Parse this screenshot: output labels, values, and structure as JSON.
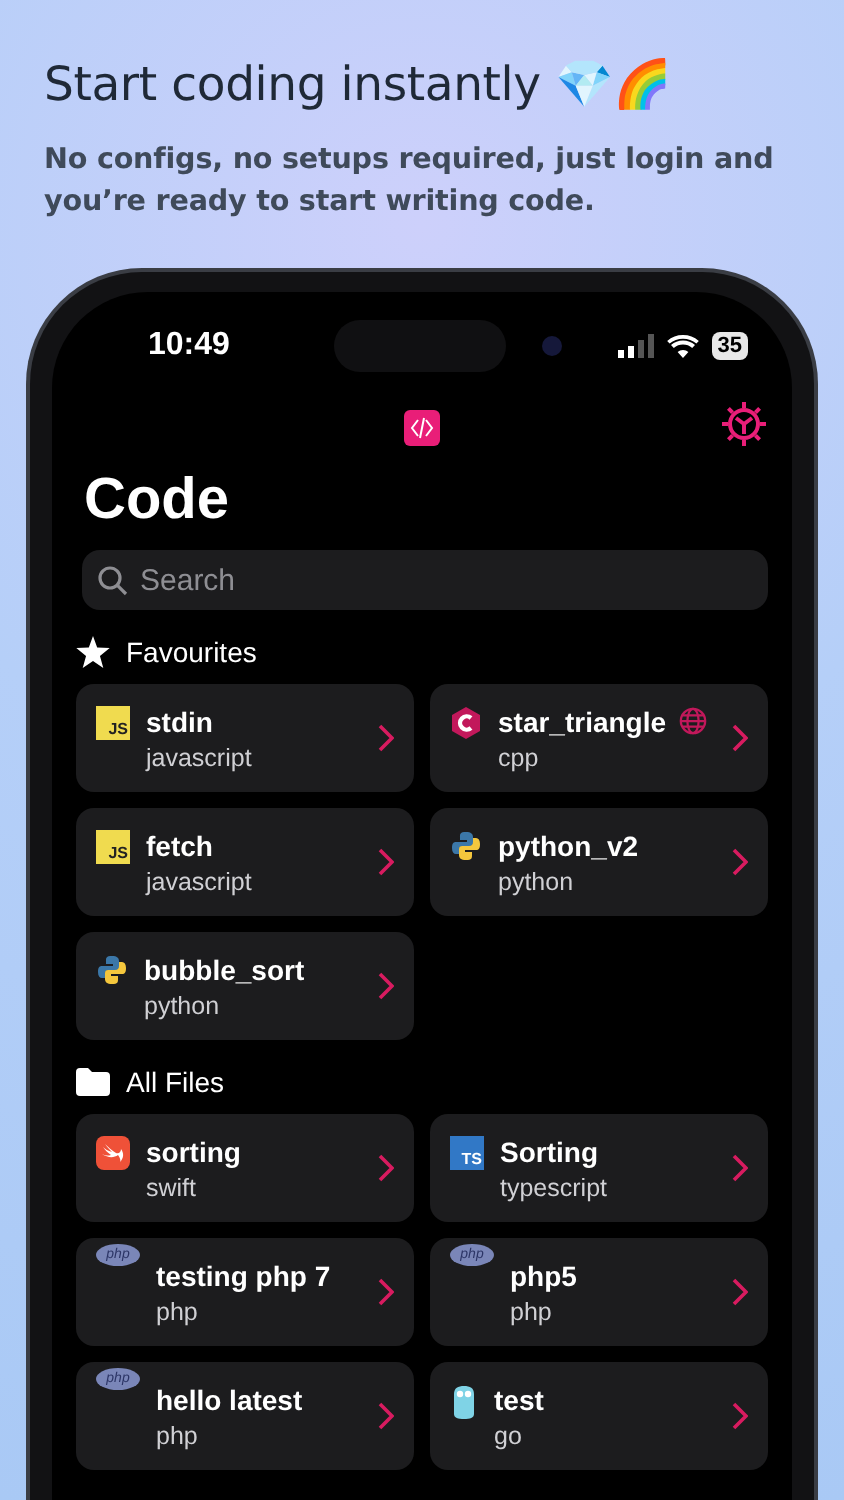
{
  "promo": {
    "title": "Start coding instantly 💎🌈",
    "subtitle": "No configs, no setups required, just login and you’re ready to start writing code."
  },
  "status_bar": {
    "time": "10:49",
    "battery": "35"
  },
  "screen": {
    "title": "Code",
    "search": {
      "placeholder": "Search"
    }
  },
  "sections": [
    {
      "kind": "favourites",
      "label": "Favourites",
      "files": [
        {
          "name": "stdin",
          "language": "javascript",
          "kind": "js",
          "icon_text": "JS",
          "shared": false
        },
        {
          "name": "star_triangle",
          "language": "cpp",
          "kind": "cpp",
          "shared": true
        },
        {
          "name": "fetch",
          "language": "javascript",
          "kind": "js",
          "icon_text": "JS",
          "shared": false
        },
        {
          "name": "python_v2",
          "language": "python",
          "kind": "python",
          "shared": false
        },
        {
          "name": "bubble_sort",
          "language": "python",
          "kind": "python",
          "shared": false
        }
      ]
    },
    {
      "kind": "folder",
      "label": "All Files",
      "files": [
        {
          "name": "sorting",
          "language": "swift",
          "kind": "swift",
          "shared": false
        },
        {
          "name": "Sorting",
          "language": "typescript",
          "kind": "ts",
          "icon_text": "TS",
          "shared": false
        },
        {
          "name": "testing php 7",
          "language": "php",
          "kind": "php",
          "icon_text": "php",
          "shared": false
        },
        {
          "name": "php5",
          "language": "php",
          "kind": "php",
          "icon_text": "php",
          "shared": false
        },
        {
          "name": "hello latest",
          "language": "php",
          "kind": "php",
          "icon_text": "php",
          "shared": false
        },
        {
          "name": "test",
          "language": "go",
          "kind": "go",
          "shared": false
        }
      ]
    }
  ]
}
